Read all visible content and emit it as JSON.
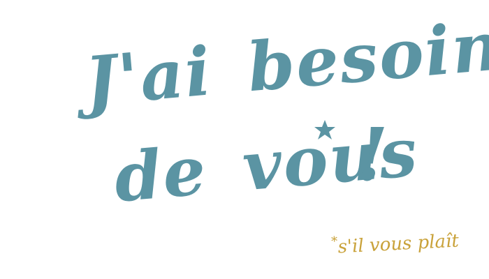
{
  "headline": {
    "line1_word1": "J'ai",
    "line1_word2": "besoin",
    "line2_word1": "de",
    "line2_word2": "vous",
    "exclamation": "!"
  },
  "asterisk_icon": "asterisk-icon",
  "footnote": {
    "marker": "*",
    "text": "s'il vous plaît"
  },
  "colors": {
    "headline": "#5b94a3",
    "footnote": "#c9a23a",
    "background": "#ffffff"
  }
}
